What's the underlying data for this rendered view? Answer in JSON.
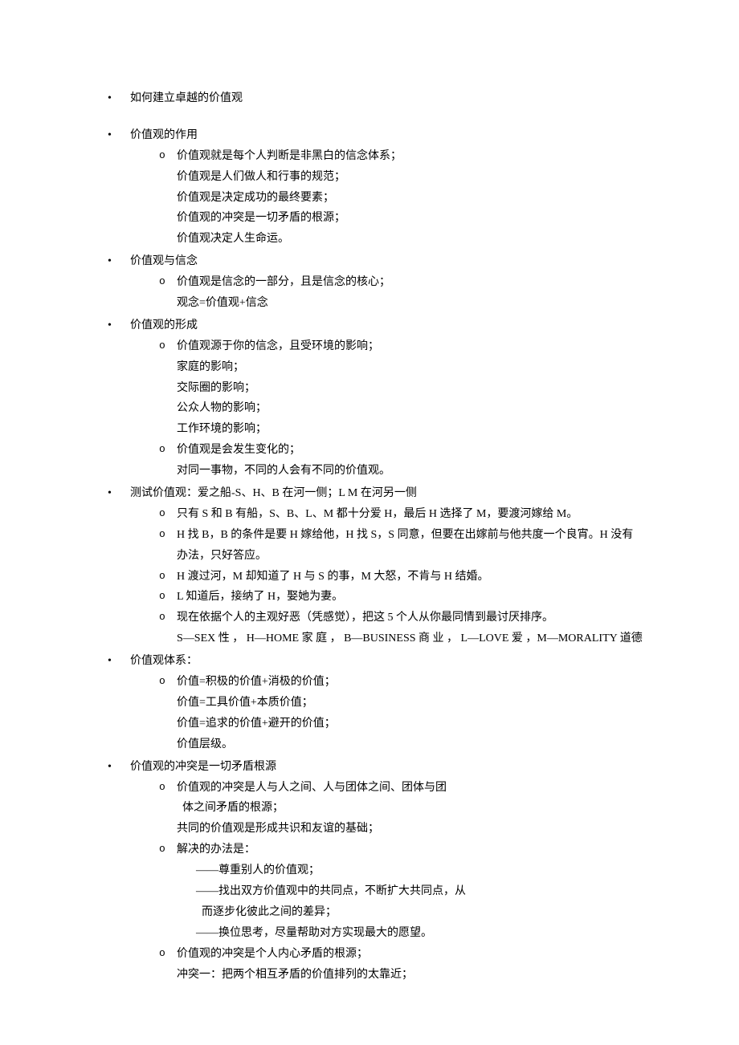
{
  "sections": [
    {
      "title": "如何建立卓越的价值观",
      "gapAfter": true
    },
    {
      "title": "价值观的作用",
      "sub": [
        {
          "bullet": true,
          "lines": [
            "价值观就是每个人判断是非黑白的信念体系；",
            "价值观是人们做人和行事的规范；",
            "价值观是决定成功的最终要素；",
            "价值观的冲突是一切矛盾的根源；",
            "价值观决定人生命运。"
          ]
        }
      ]
    },
    {
      "title": "价值观与信念",
      "sub": [
        {
          "bullet": true,
          "lines": [
            "价值观是信念的一部分，且是信念的核心；",
            "观念=价值观+信念"
          ]
        }
      ]
    },
    {
      "title": "价值观的形成",
      "sub": [
        {
          "bullet": true,
          "lines": [
            "价值观源于你的信念，且受环境的影响；",
            "家庭的影响；",
            "交际圈的影响；",
            "公众人物的影响；",
            "工作环境的影响；"
          ]
        },
        {
          "bullet": true,
          "lines": [
            "价值观是会发生变化的；",
            "对同一事物，不同的人会有不同的价值观。"
          ]
        }
      ]
    },
    {
      "title": "测试价值观：爱之船-S、H、B 在河一侧；L M 在河另一侧",
      "sub": [
        {
          "bullet": true,
          "lines": [
            "只有 S 和 B 有船，S、B、L、M 都十分爱 H，最后 H 选择了 M，要渡河嫁给 M。"
          ]
        },
        {
          "bullet": true,
          "lines": [
            "H 找 B，B 的条件是要 H 嫁给他，H 找 S，S 同意，但要在出嫁前与他共度一个良宵。H 没有办法，只好答应。"
          ]
        },
        {
          "bullet": true,
          "lines": [
            "H 渡过河，M 却知道了 H 与 S 的事，M 大怒，不肯与 H 结婚。"
          ]
        },
        {
          "bullet": true,
          "lines": [
            "L 知道后，接纳了 H，娶她为妻。"
          ]
        },
        {
          "bullet": true,
          "lines": [
            "现在依据个人的主观好恶（凭感觉），把这 5 个人从你最同情到最讨厌排序。"
          ]
        },
        {
          "bullet": false,
          "justify": true,
          "lines": [
            "S—SEX 性 ， H—HOME 家 庭 ， B—BUSINESS 商 业 ， L—LOVE 爱 ，M—MORALITY 道德"
          ]
        }
      ]
    },
    {
      "title": "价值观体系：",
      "sub": [
        {
          "bullet": true,
          "lines": [
            "价值=积极的价值+消极的价值；",
            "价值=工具价值+本质价值；",
            "价值=追求的价值+避开的价值；",
            "价值层级。"
          ]
        }
      ]
    },
    {
      "title": "价值观的冲突是一切矛盾根源",
      "sub": [
        {
          "bullet": true,
          "lines": [
            "价值观的冲突是人与人之间、人与团体之间、团体与团",
            "  体之间矛盾的根源；",
            "共同的价值观是形成共识和友谊的基础；"
          ]
        },
        {
          "bullet": true,
          "lines": [
            "解决的办法是："
          ],
          "subitems": [
            "——尊重别人的价值观；",
            "——找出双方价值观中的共同点，不断扩大共同点，从",
            "  而逐步化彼此之间的差异；",
            "——换位思考，尽量帮助对方实现最大的愿望。"
          ]
        },
        {
          "bullet": true,
          "lines": [
            "价值观的冲突是个人内心矛盾的根源；",
            "冲突一：把两个相互矛盾的价值排列的太靠近；"
          ]
        }
      ]
    }
  ]
}
